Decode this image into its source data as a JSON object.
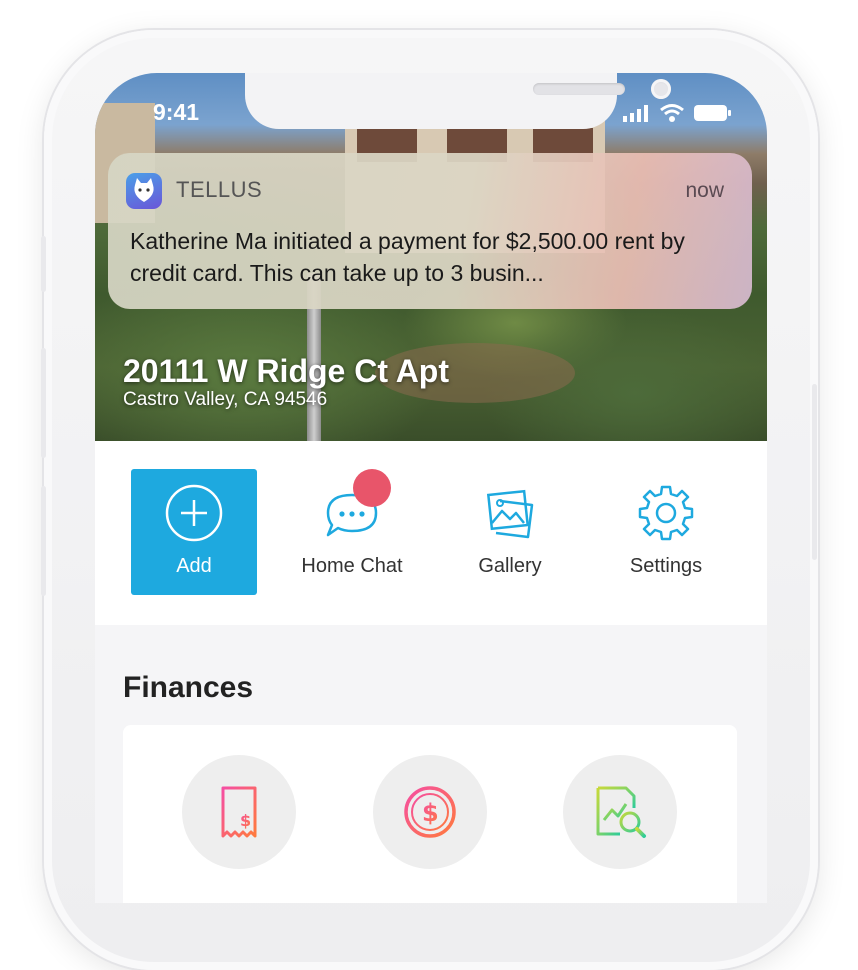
{
  "status_bar": {
    "time": "9:41"
  },
  "notification": {
    "app_name": "TELLUS",
    "time": "now",
    "body": "Katherine Ma initiated a payment for $2,500.00 rent by credit card. This can take up to 3 busin..."
  },
  "property": {
    "address": "20111 W Ridge Ct Apt",
    "city": "Castro Valley, CA 94546"
  },
  "actions": [
    {
      "label": "Add",
      "icon": "plus-circle-icon"
    },
    {
      "label": "Home Chat",
      "icon": "chat-bubble-icon"
    },
    {
      "label": "Gallery",
      "icon": "gallery-icon"
    },
    {
      "label": "Settings",
      "icon": "gear-icon"
    }
  ],
  "finances": {
    "title": "Finances",
    "items": [
      {
        "icon": "receipt-icon"
      },
      {
        "icon": "dollar-circle-icon"
      },
      {
        "icon": "report-search-icon"
      }
    ]
  },
  "colors": {
    "accent": "#1ea9df",
    "badge": "#e8556a"
  }
}
